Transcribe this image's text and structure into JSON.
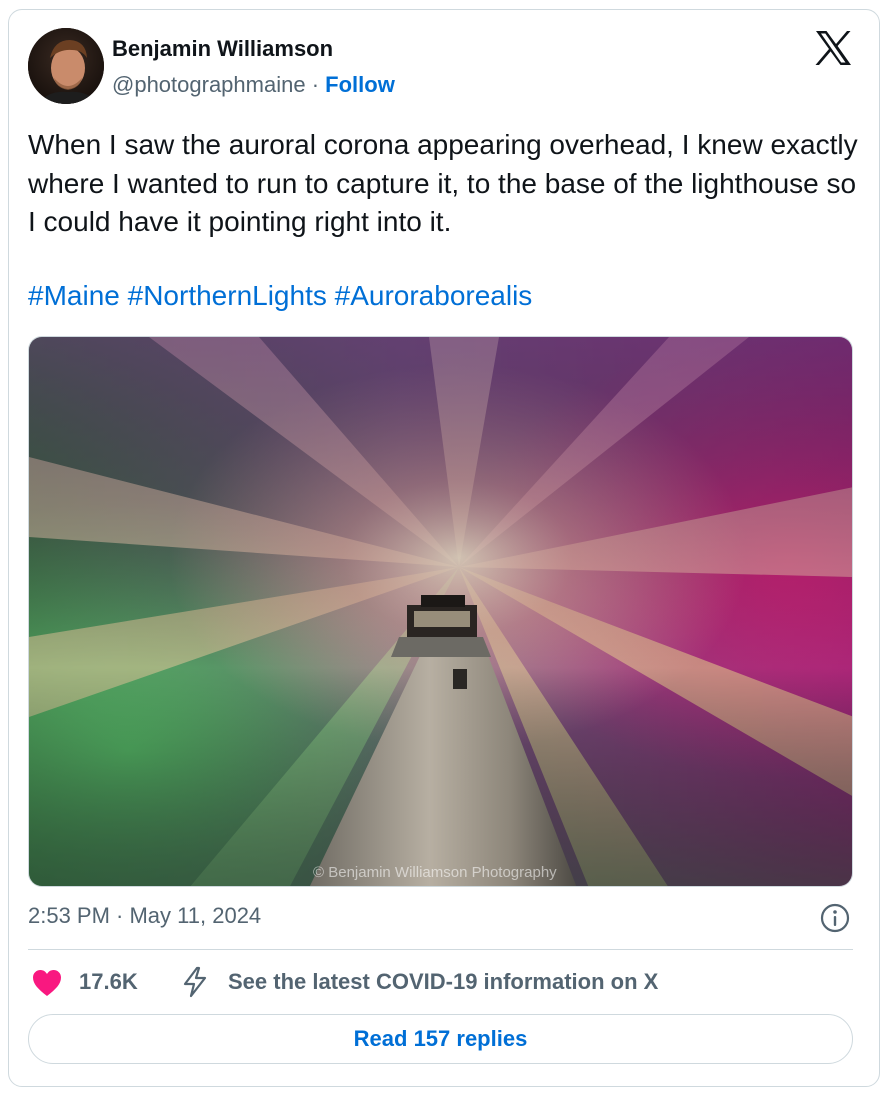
{
  "author": {
    "name": "Benjamin Williamson",
    "handle": "@photographmaine",
    "separator": "·",
    "follow_label": "Follow"
  },
  "tweet": {
    "text": "When I saw the auroral corona appearing overhead, I knew exactly where I wanted to run to capture it, to the base of the lighthouse so I could have it pointing right into it.",
    "hashtags": [
      "#Maine",
      "#NorthernLights",
      "#Auroraborealis"
    ]
  },
  "media": {
    "watermark": "© Benjamin Williamson Photography"
  },
  "meta": {
    "timestamp": "2:53 PM · May 11, 2024"
  },
  "actions": {
    "likes": "17.6K",
    "covid_link": "See the latest COVID-19 information on X",
    "replies_button": "Read 157 replies"
  },
  "colors": {
    "link": "#006fd6",
    "like": "#f91880",
    "secondary_text": "#536471",
    "border": "#cfd9de"
  },
  "icons": [
    "x-logo-icon",
    "info-icon",
    "heart-icon",
    "lightning-bolt-icon"
  ]
}
